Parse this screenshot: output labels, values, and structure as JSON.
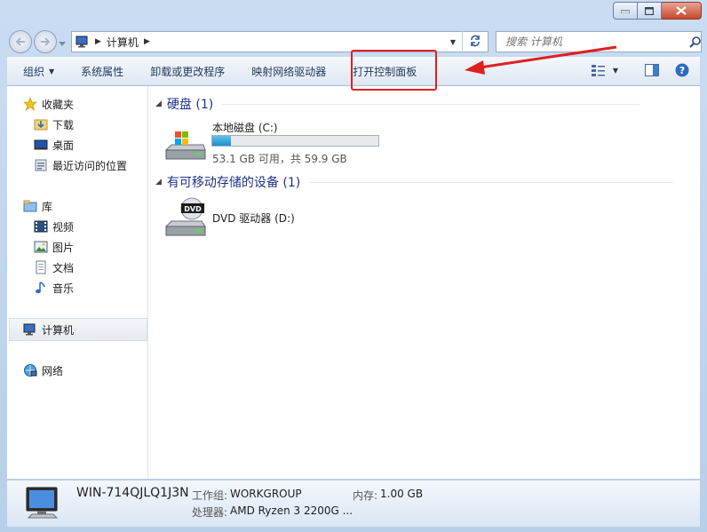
{
  "address": {
    "root_label": "计算机"
  },
  "search": {
    "placeholder": "搜索 计算机"
  },
  "toolbar": {
    "organize": "组织",
    "system_properties": "系统属性",
    "uninstall": "卸载或更改程序",
    "map_drive": "映射网络驱动器",
    "open_control_panel": "打开控制面板"
  },
  "sidebar": {
    "favorites": "收藏夹",
    "downloads": "下载",
    "desktop": "桌面",
    "recent": "最近访问的位置",
    "libraries": "库",
    "videos": "视频",
    "pictures": "图片",
    "documents": "文档",
    "music": "音乐",
    "computer": "计算机",
    "network": "网络"
  },
  "content": {
    "hard_disks_header": "硬盘 (1)",
    "local_disk_name": "本地磁盘 (C:)",
    "local_disk_free": "53.1 GB 可用，共 59.9 GB",
    "local_disk_used_fraction": 0.114,
    "removable_header": "有可移动存储的设备 (1)",
    "dvd_name": "DVD 驱动器 (D:)",
    "dvd_badge": "DVD"
  },
  "status": {
    "computer_name": "WIN-714QJLQ1J3N",
    "workgroup_label": "工作组:",
    "workgroup_value": "WORKGROUP",
    "memory_label": "内存:",
    "memory_value": "1.00 GB",
    "processor_label": "处理器:",
    "processor_value": "AMD Ryzen 3 2200G ..."
  },
  "colors": {
    "highlight": "#e02020",
    "link": "#1e3287",
    "bar_fill": "#26a0da"
  }
}
